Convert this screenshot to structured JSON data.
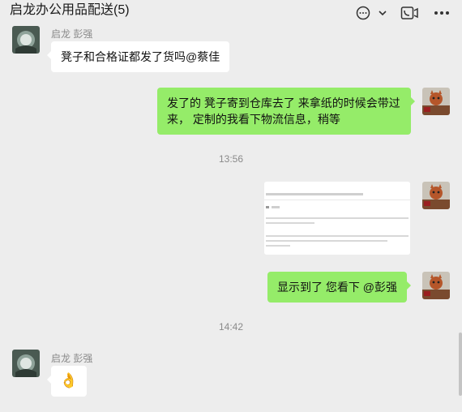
{
  "header": {
    "title": "启龙办公用品配送(5)"
  },
  "messages": {
    "m1": {
      "sender": "启龙 彭强",
      "text": "凳子和合格证都发了货吗@蔡佳"
    },
    "m2": {
      "text": "发了的 凳子寄到仓库去了 来拿纸的时候会带过来， 定制的我看下物流信息，稍等"
    },
    "time1": "13:56",
    "m4": {
      "text": "显示到了 您看下  @彭强"
    },
    "time2": "14:42",
    "m5": {
      "sender": "启龙 彭强",
      "text": "👌"
    }
  },
  "colors": {
    "background": "#ededed",
    "outgoing_bubble": "#95ec69",
    "incoming_bubble": "#ffffff"
  }
}
